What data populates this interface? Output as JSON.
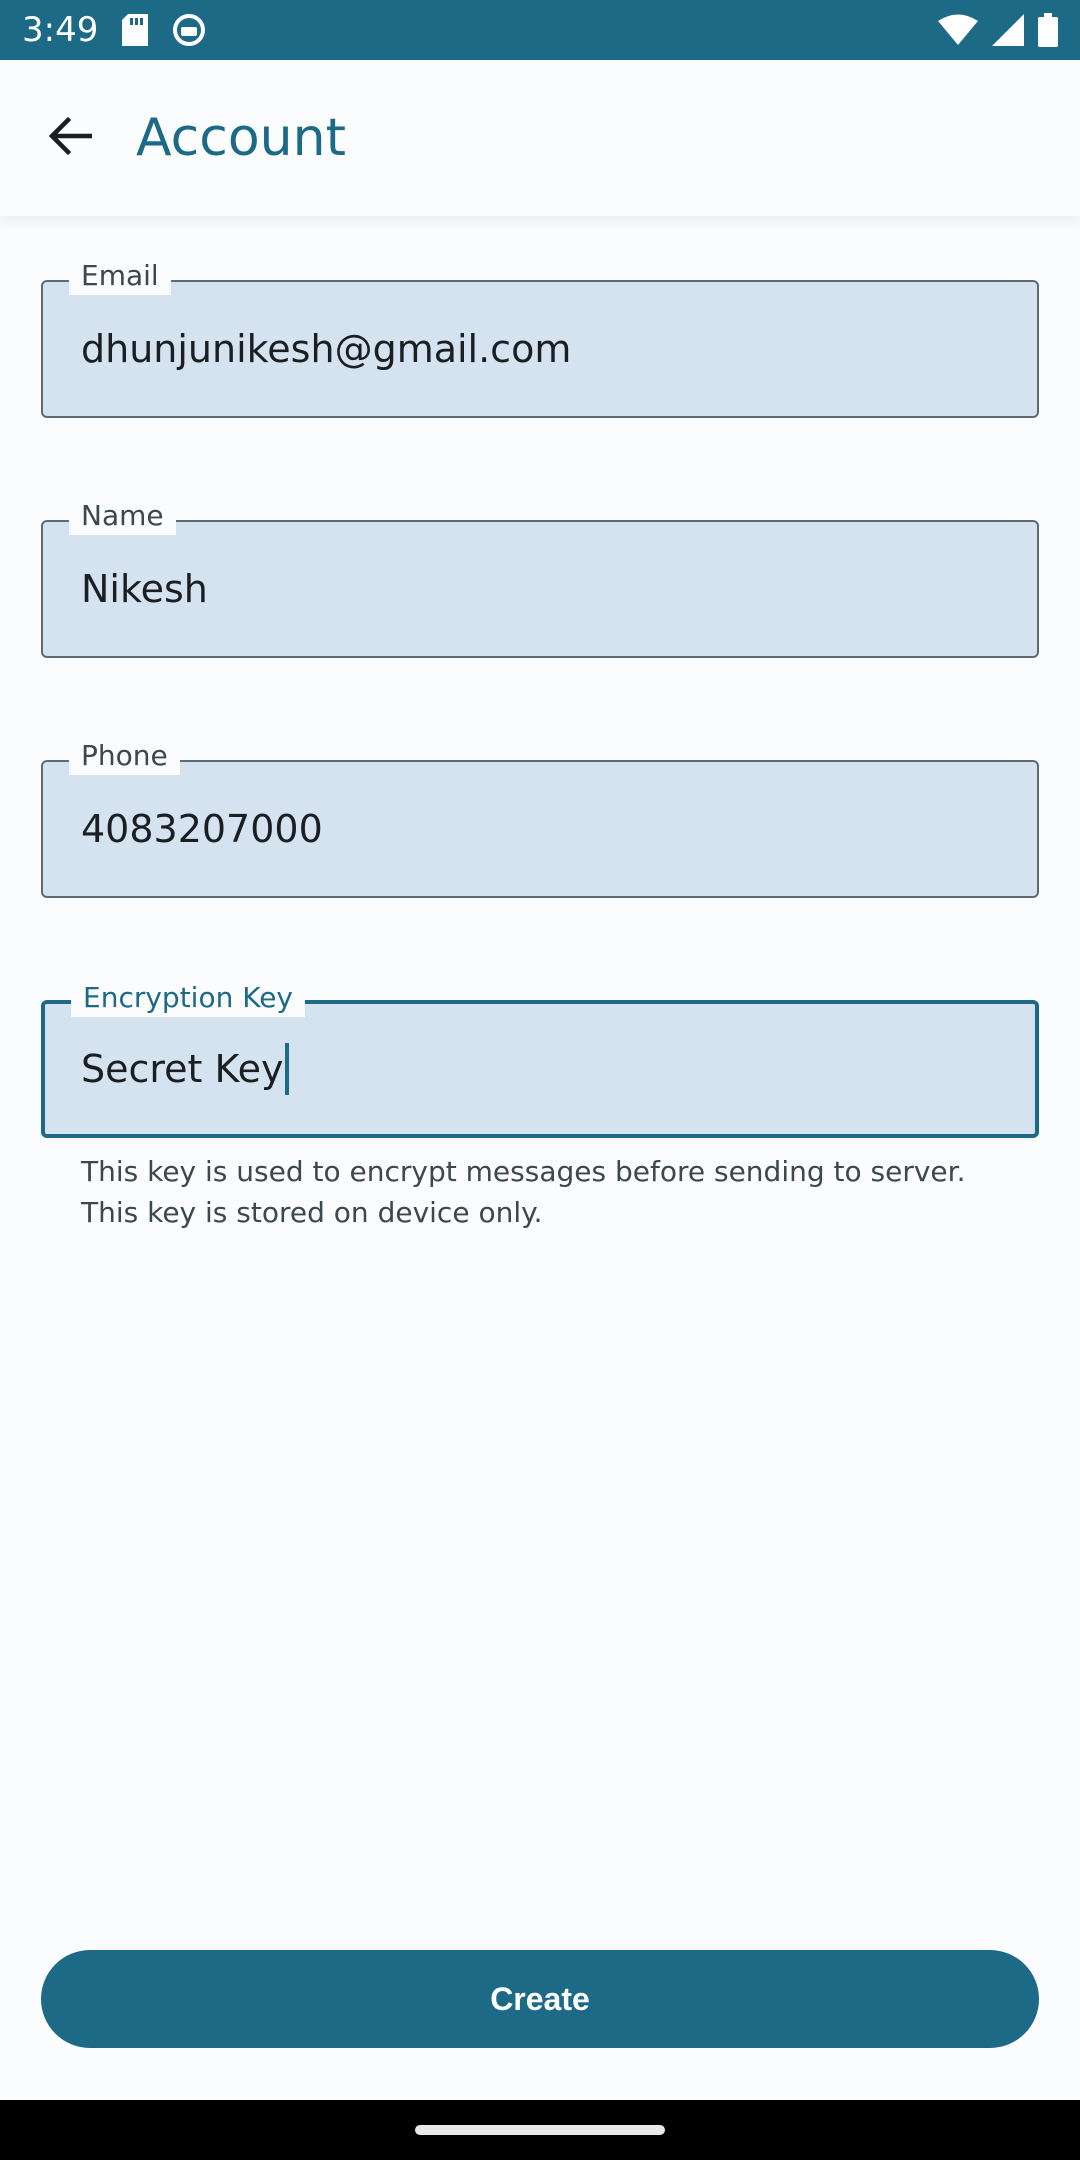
{
  "status_bar": {
    "time": "3:49",
    "icons": [
      "sd-card-icon",
      "app-notification-icon",
      "wifi-icon",
      "signal-icon",
      "battery-icon"
    ]
  },
  "app_bar": {
    "title": "Account",
    "back_icon": "arrow-left-icon"
  },
  "form": {
    "email": {
      "label": "Email",
      "value": "dhunjunikesh@gmail.com"
    },
    "name": {
      "label": "Name",
      "value": "Nikesh"
    },
    "phone": {
      "label": "Phone",
      "value": "4083207000"
    },
    "encryption_key": {
      "label": "Encryption Key",
      "value": "Secret Key",
      "helper_line1": "This key is used to encrypt messages before sending to server.",
      "helper_line2": "This key is stored on device only."
    }
  },
  "actions": {
    "create_label": "Create"
  },
  "colors": {
    "primary": "#1d6a87",
    "field_fill": "#d5e3f1",
    "background": "#fbfcfd"
  }
}
